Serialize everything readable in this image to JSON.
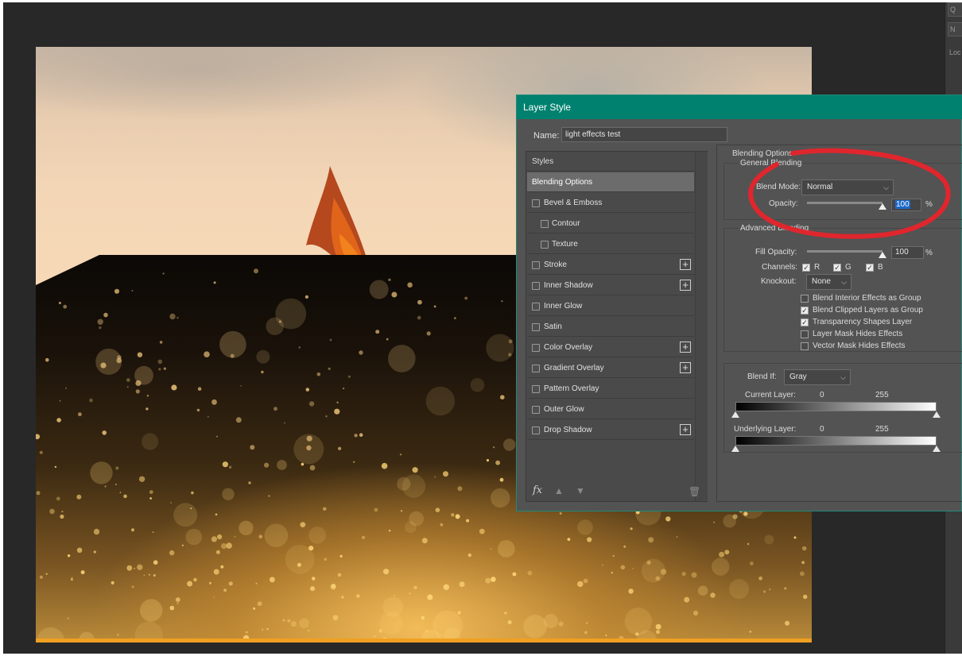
{
  "right_panel": {
    "btn1": "Q",
    "btn2": "N",
    "label": "Loc"
  },
  "dialog": {
    "title": "Layer Style",
    "name_label": "Name:",
    "name_value": "light effects test"
  },
  "styles": {
    "items": [
      {
        "label": "Styles",
        "checkbox": false,
        "plus": false,
        "selected": false,
        "indent": false
      },
      {
        "label": "Blending Options",
        "checkbox": false,
        "plus": false,
        "selected": true,
        "indent": false
      },
      {
        "label": "Bevel & Emboss",
        "checkbox": true,
        "plus": false,
        "selected": false,
        "indent": false
      },
      {
        "label": "Contour",
        "checkbox": true,
        "plus": false,
        "selected": false,
        "indent": true
      },
      {
        "label": "Texture",
        "checkbox": true,
        "plus": false,
        "selected": false,
        "indent": true
      },
      {
        "label": "Stroke",
        "checkbox": true,
        "plus": true,
        "selected": false,
        "indent": false
      },
      {
        "label": "Inner Shadow",
        "checkbox": true,
        "plus": true,
        "selected": false,
        "indent": false
      },
      {
        "label": "Inner Glow",
        "checkbox": true,
        "plus": false,
        "selected": false,
        "indent": false
      },
      {
        "label": "Satin",
        "checkbox": true,
        "plus": false,
        "selected": false,
        "indent": false
      },
      {
        "label": "Color Overlay",
        "checkbox": true,
        "plus": true,
        "selected": false,
        "indent": false
      },
      {
        "label": "Gradient Overlay",
        "checkbox": true,
        "plus": true,
        "selected": false,
        "indent": false
      },
      {
        "label": "Pattern Overlay",
        "checkbox": true,
        "plus": false,
        "selected": false,
        "indent": false
      },
      {
        "label": "Outer Glow",
        "checkbox": true,
        "plus": false,
        "selected": false,
        "indent": false
      },
      {
        "label": "Drop Shadow",
        "checkbox": true,
        "plus": true,
        "selected": false,
        "indent": false
      }
    ],
    "footer": {
      "fx": "fx",
      "plus_glyph": "+"
    }
  },
  "blending": {
    "section_title": "Blending Options",
    "general": {
      "title": "General Blending",
      "blend_mode_label": "Blend Mode:",
      "blend_mode_value": "Normal",
      "opacity_label": "Opacity:",
      "opacity_value": "100",
      "opacity_level": 1.0,
      "percent": "%"
    },
    "advanced": {
      "title": "Advanced Blending",
      "fill_label": "Fill Opacity:",
      "fill_value": "100",
      "fill_level": 1.0,
      "percent": "%",
      "channels_label": "Channels:",
      "channels": [
        {
          "label": "R",
          "checked": true
        },
        {
          "label": "G",
          "checked": true
        },
        {
          "label": "B",
          "checked": true
        }
      ],
      "knockout_label": "Knockout:",
      "knockout_value": "None",
      "options": [
        {
          "label": "Blend Interior Effects as Group",
          "checked": false
        },
        {
          "label": "Blend Clipped Layers as Group",
          "checked": true
        },
        {
          "label": "Transparency Shapes Layer",
          "checked": true
        },
        {
          "label": "Layer Mask Hides Effects",
          "checked": false
        },
        {
          "label": "Vector Mask Hides Effects",
          "checked": false
        }
      ]
    },
    "blend_if": {
      "label": "Blend If:",
      "value": "Gray",
      "current_label": "Current Layer:",
      "current_low": "0",
      "current_high": "255",
      "underlying_label": "Underlying Layer:",
      "underlying_low": "0",
      "underlying_high": "255"
    }
  },
  "colors": {
    "titlebar": "#008170",
    "annotation": "#e0262d",
    "selection": "#1c68c8"
  }
}
